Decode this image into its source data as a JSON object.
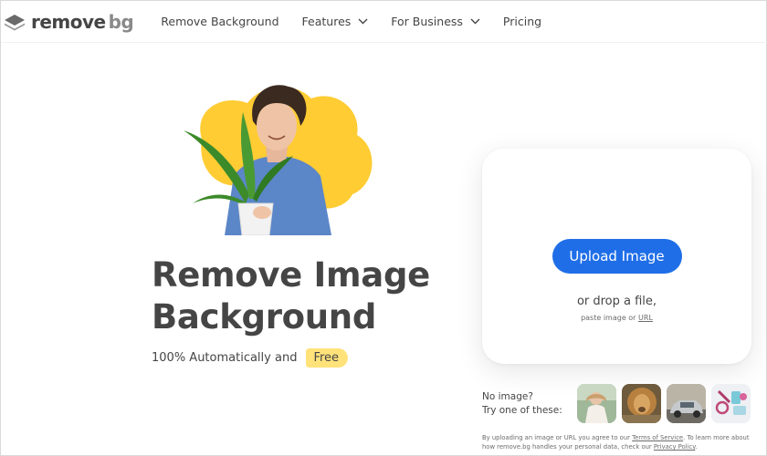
{
  "brand": {
    "name": "remove",
    "suffix": "bg",
    "icon": "layers-logo-icon"
  },
  "nav": {
    "items": [
      {
        "label": "Remove Background",
        "has_dropdown": false
      },
      {
        "label": "Features",
        "has_dropdown": true
      },
      {
        "label": "For Business",
        "has_dropdown": true
      },
      {
        "label": "Pricing",
        "has_dropdown": false
      }
    ]
  },
  "hero": {
    "title_line1": "Remove Image",
    "title_line2": "Background",
    "subtitle": "100% Automatically and",
    "badge": "Free"
  },
  "upload": {
    "button_label": "Upload Image",
    "drop_text": "or drop a file,",
    "paste_text": "paste image or",
    "url_link": "URL"
  },
  "samples": {
    "prompt_line1": "No image?",
    "prompt_line2": "Try one of these:",
    "thumbnails": [
      "sample-woman-photo",
      "sample-lion-photo",
      "sample-car-photo",
      "sample-gadgets-photo"
    ]
  },
  "legal": {
    "text_1": "By uploading an image or URL you agree to our",
    "terms_link": "Terms of Service",
    "text_2": ". To learn more about how remove.bg handles your personal data, check our",
    "privacy_link": "Privacy Policy",
    "text_3": "."
  },
  "colors": {
    "primary": "#1f6ee8",
    "text": "#454545",
    "accent_yellow": "#ffcc33",
    "badge_yellow": "#ffe27a"
  }
}
